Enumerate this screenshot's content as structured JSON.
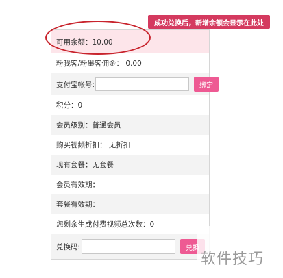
{
  "colors": {
    "accent_pink": "#ee5a93",
    "callout_red": "#d43a5f",
    "highlight_row": "#fde5ea",
    "ellipse_red": "#c8232c"
  },
  "callout": {
    "text": "成功兑换后，新增余额会显示在此处"
  },
  "account": {
    "balance": "可用余额：10.00",
    "fans_commission": "粉我客/粉墨客佣金： 0.00",
    "alipay_label": "支付宝帐号:",
    "alipay_value": "",
    "bind_button": "绑定",
    "points": "积分：0",
    "member_level": "会员级别：普通会员",
    "video_discount": "购买视频折扣： 无折扣",
    "current_package": "现有套餐：无套餐",
    "member_validity": "会员有效期：",
    "package_validity": "套餐有效期：",
    "remaining_generations": "您剩余生成付费视频总次数：0",
    "redeem_label": "兑换码:",
    "redeem_value": "",
    "redeem_button": "兑换"
  },
  "watermark": "软件技巧"
}
